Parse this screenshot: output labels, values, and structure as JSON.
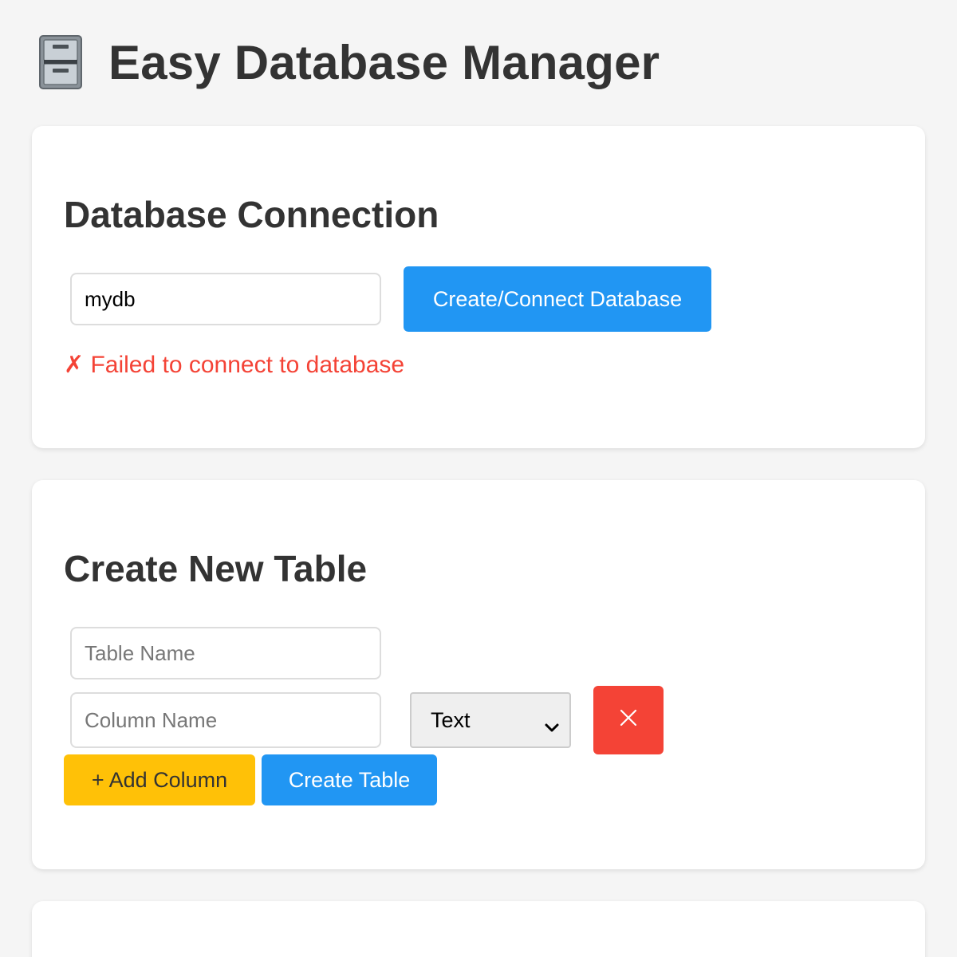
{
  "app": {
    "title": "Easy Database Manager",
    "icon": "file-cabinet-icon"
  },
  "connection": {
    "title": "Database Connection",
    "db_name_value": "mydb",
    "connect_button": "Create/Connect Database",
    "status_text": "✗ Failed to connect to database"
  },
  "create_table": {
    "title": "Create New Table",
    "table_name_placeholder": "Table Name",
    "column": {
      "name_placeholder": "Column Name",
      "type_selected": "Text",
      "delete_icon": "close-icon"
    },
    "add_column_button": "+ Add Column",
    "create_table_button": "Create Table"
  },
  "colors": {
    "primary": "#2196f3",
    "danger": "#f44336",
    "warning": "#ffc107",
    "background": "#f5f5f5",
    "card": "#ffffff",
    "text": "#333333"
  }
}
